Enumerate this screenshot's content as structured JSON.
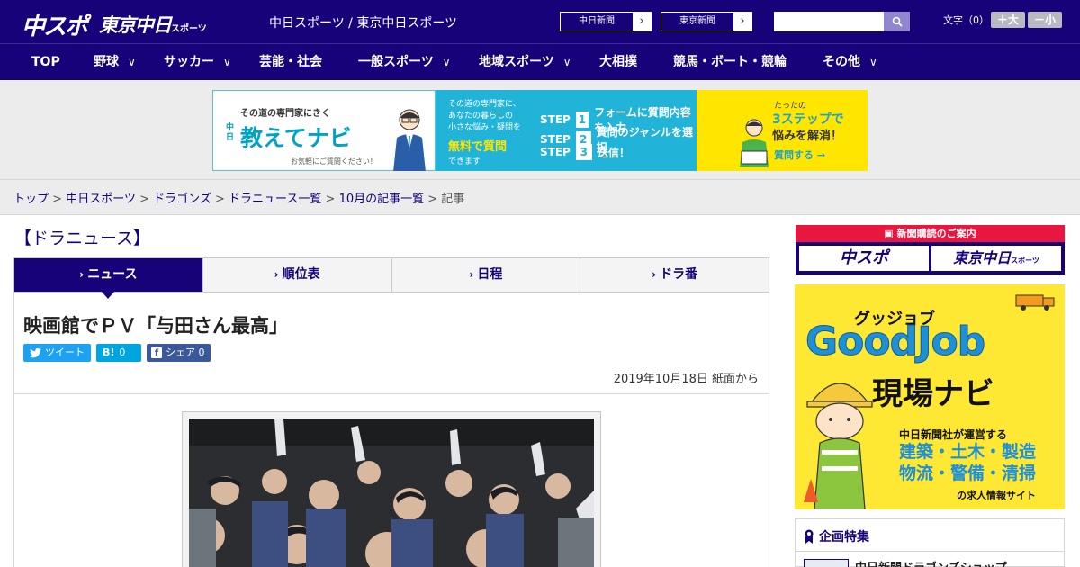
{
  "header": {
    "logo_chunichi": "中スポ",
    "logo_tokyo": "東京中日",
    "logo_tokyo_small": "スポーツ",
    "site_name": "中日スポーツ / 東京中日スポーツ",
    "paper_buttons": [
      {
        "label": "中日新聞"
      },
      {
        "label": "東京新聞"
      }
    ],
    "search_placeholder": "",
    "font_size_label": "文字（0）",
    "font_larger": "＋大",
    "font_smaller": "－小"
  },
  "nav": {
    "items": [
      {
        "label": "TOP",
        "dropdown": false
      },
      {
        "label": "野球",
        "dropdown": true
      },
      {
        "label": "サッカー",
        "dropdown": true
      },
      {
        "label": "芸能・社会",
        "dropdown": false
      },
      {
        "label": "一般スポーツ",
        "dropdown": true
      },
      {
        "label": "地域スポーツ",
        "dropdown": true
      },
      {
        "label": "大相撲",
        "dropdown": false
      },
      {
        "label": "競馬・ボート・競輪",
        "dropdown": false
      },
      {
        "label": "その他",
        "dropdown": true
      }
    ]
  },
  "banner": {
    "tagline": "その道の専門家にきく",
    "brand_prefix": "中日",
    "brand": "教えてナビ",
    "note": "お気軽にご質問ください！",
    "mid_lines": [
      "その道の専門家に、",
      "あなたの暮らしの",
      "小さな悩み・疑問を"
    ],
    "free": "無料で質問",
    "mid_end": "できます",
    "steps": [
      {
        "label": "STEP",
        "num": "1",
        "text": "フォームに質問内容を入力"
      },
      {
        "label": "STEP",
        "num": "2",
        "text": "質問のジャンルを選択"
      },
      {
        "label": "STEP",
        "num": "3",
        "text": "送信！"
      }
    ],
    "right_l1": "たったの",
    "right_l2": "3ステップで",
    "right_l3": "悩みを解消！",
    "right_cta": "質問する →"
  },
  "breadcrumb": {
    "items": [
      "トップ",
      "中日スポーツ",
      "ドラゴンズ",
      "ドラニュース一覧",
      "10月の記事一覧"
    ],
    "current": "記事",
    "sep": " > "
  },
  "section": {
    "title": "【ドラニュース】"
  },
  "tabs": [
    {
      "label": "ニュース",
      "active": true
    },
    {
      "label": "順位表",
      "active": false
    },
    {
      "label": "日程",
      "active": false
    },
    {
      "label": "ドラ番",
      "active": false
    }
  ],
  "article": {
    "headline": "映画館でＰＶ「与田さん最高」",
    "date": "2019年10月18日 紙面から",
    "share": {
      "tweet": "ツイート",
      "hatena_count": "0",
      "facebook": "シェア",
      "facebook_count": "0"
    }
  },
  "sidebar": {
    "subscribe_head": "新聞購読のご案内",
    "subscribe_logos": [
      "中スポ",
      "東京中日"
    ],
    "subscribe_logo_small": "スポーツ",
    "goodjob": {
      "kana": "グッジョブ",
      "word": "GoodJob",
      "navi": "現場ナビ",
      "sub": "中日新聞社が運営する",
      "list": [
        "建築・土木・製造",
        "物流・警備・清掃"
      ],
      "foot": "の求人情報サイト"
    },
    "feature_head": "企画特集",
    "feature_item": "中日新聞ドラゴンズショップ"
  },
  "colors": {
    "brand": "#17027a",
    "accent_red": "#e8173f",
    "twitter": "#1da1f2",
    "hatena": "#00a4de",
    "facebook": "#3b5998"
  }
}
